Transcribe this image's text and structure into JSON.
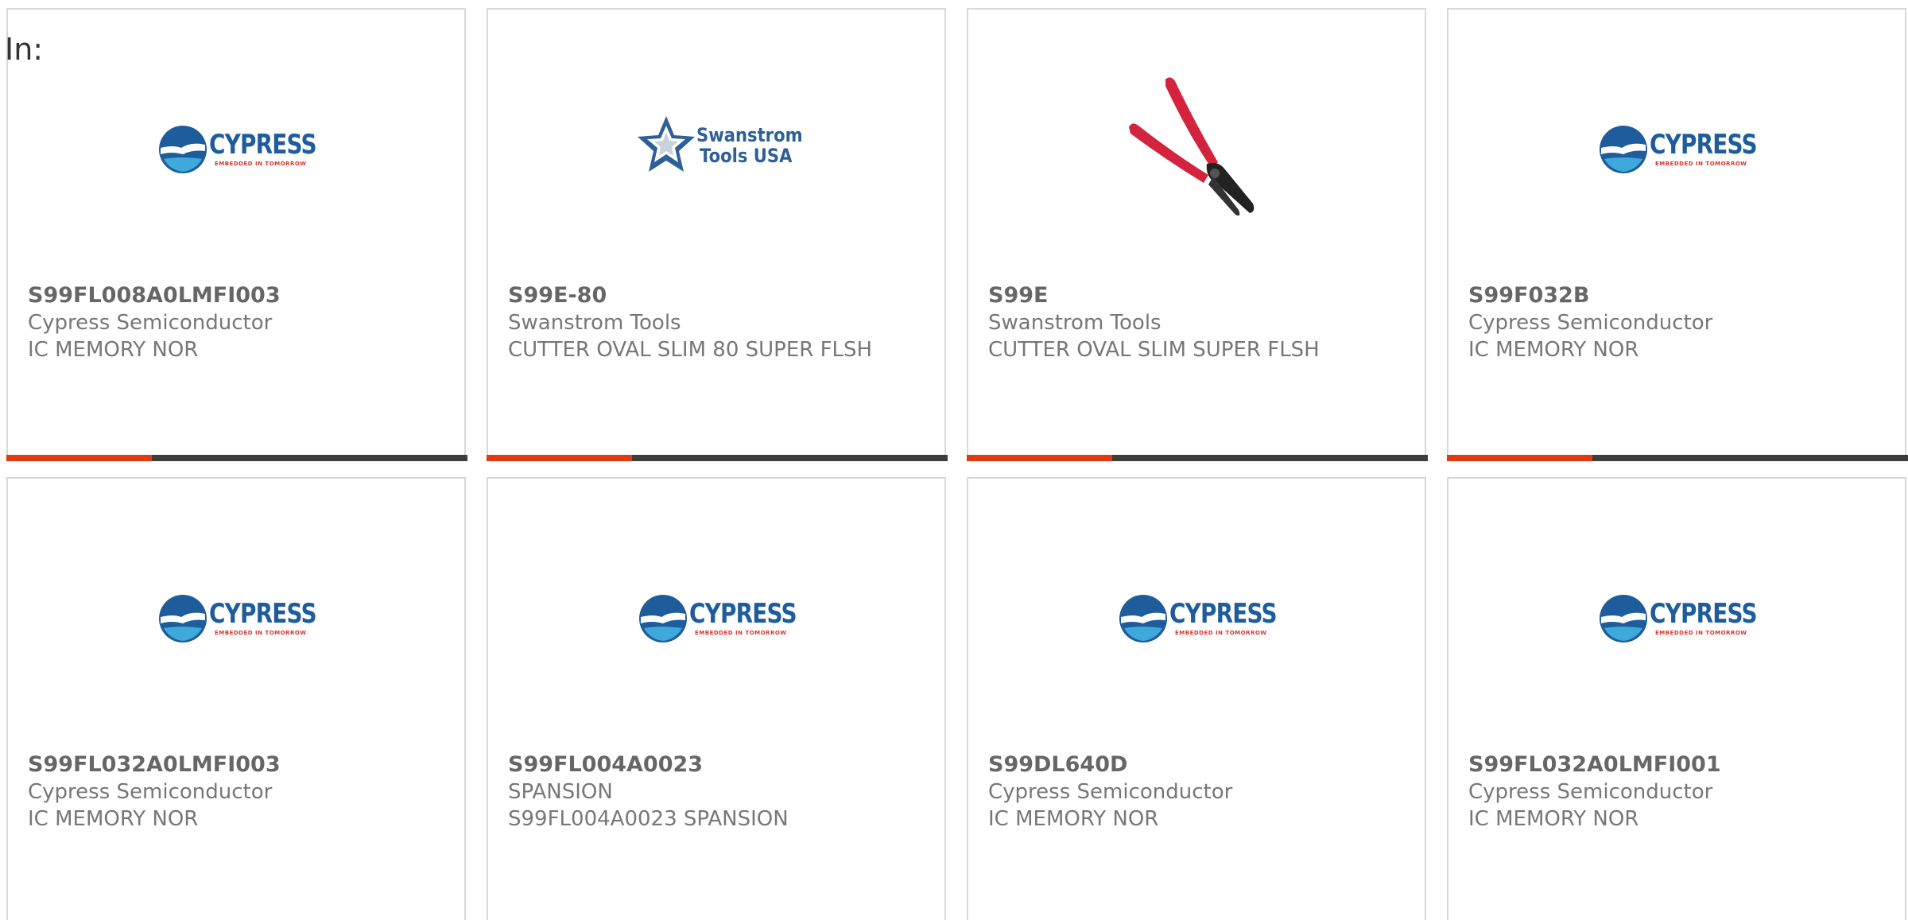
{
  "header": {
    "in_label": "In:"
  },
  "brand_logos": {
    "cypress": {
      "word": "CYPRESS",
      "tagline": "EMBEDDED IN TOMORROW"
    },
    "swanstrom": {
      "line1": "Swanstrom",
      "line2": "Tools USA"
    }
  },
  "colors": {
    "accent_bar": "#e03a12",
    "bar_dark": "#3d3d3d",
    "cypress_blue": "#1f5c9c",
    "cypress_red": "#d9342b",
    "plier_red": "#d4233e"
  },
  "products": [
    {
      "part": "S99FL008A0LMFI003",
      "manufacturer": "Cypress Semiconductor",
      "description": "IC MEMORY NOR",
      "logo": "cypress-logo"
    },
    {
      "part": "S99E-80",
      "manufacturer": "Swanstrom Tools",
      "description": "CUTTER OVAL SLIM 80 SUPER FLSH",
      "logo": "swanstrom-logo"
    },
    {
      "part": "S99E",
      "manufacturer": "Swanstrom Tools",
      "description": "CUTTER OVAL SLIM SUPER FLSH",
      "logo": "cutter-pliers-icon"
    },
    {
      "part": "S99F032B",
      "manufacturer": "Cypress Semiconductor",
      "description": "IC MEMORY NOR",
      "logo": "cypress-logo"
    },
    {
      "part": "S99FL032A0LMFI003",
      "manufacturer": "Cypress Semiconductor",
      "description": "IC MEMORY NOR",
      "logo": "cypress-logo"
    },
    {
      "part": "S99FL004A0023",
      "manufacturer": "SPANSION",
      "description": "S99FL004A0023 SPANSION",
      "logo": "cypress-logo"
    },
    {
      "part": "S99DL640D",
      "manufacturer": "Cypress Semiconductor",
      "description": "IC MEMORY NOR",
      "logo": "cypress-logo"
    },
    {
      "part": "S99FL032A0LMFI001",
      "manufacturer": "Cypress Semiconductor",
      "description": "IC MEMORY NOR",
      "logo": "cypress-logo"
    }
  ]
}
